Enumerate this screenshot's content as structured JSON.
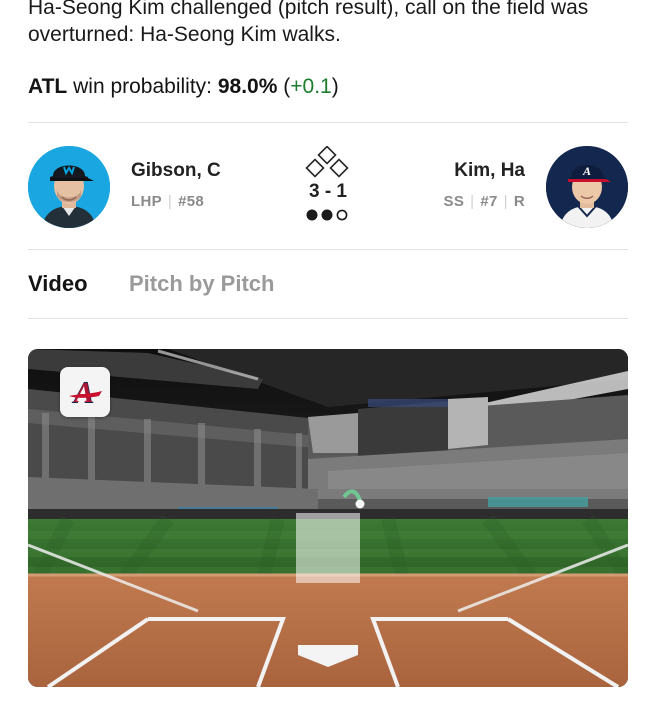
{
  "play": {
    "description": "Ha-Seong Kim challenged (pitch result), call on the field was overturned: Ha-Seong Kim walks."
  },
  "win_probability": {
    "team": "ATL",
    "label": "win probability:",
    "value": "98.0%",
    "change": "+0.1"
  },
  "matchup": {
    "pitcher": {
      "name": "Gibson, C",
      "throws": "LHP",
      "number": "#58",
      "team_logo": "marlins-logo"
    },
    "batter": {
      "name": "Kim, Ha",
      "position": "SS",
      "number": "#7",
      "bats": "R",
      "team_logo": "braves-logo"
    },
    "count": "3 - 1",
    "bases": {
      "first": false,
      "second": false,
      "third": false
    },
    "outs": {
      "filled": 2,
      "total": 3
    }
  },
  "tabs": [
    {
      "label": "Video",
      "active": true
    },
    {
      "label": "Pitch by Pitch",
      "active": false
    }
  ],
  "video": {
    "overlay_logo": "braves-logo",
    "colors": {
      "grass": "#2f6b2a",
      "dirt": "#b4714a",
      "sky": "#1c1c1c"
    }
  },
  "colors": {
    "positive_change": "#1b7d2e",
    "muted": "#9a9a9a",
    "marlins_blue": "#00a3e0",
    "braves_navy": "#13274f"
  }
}
